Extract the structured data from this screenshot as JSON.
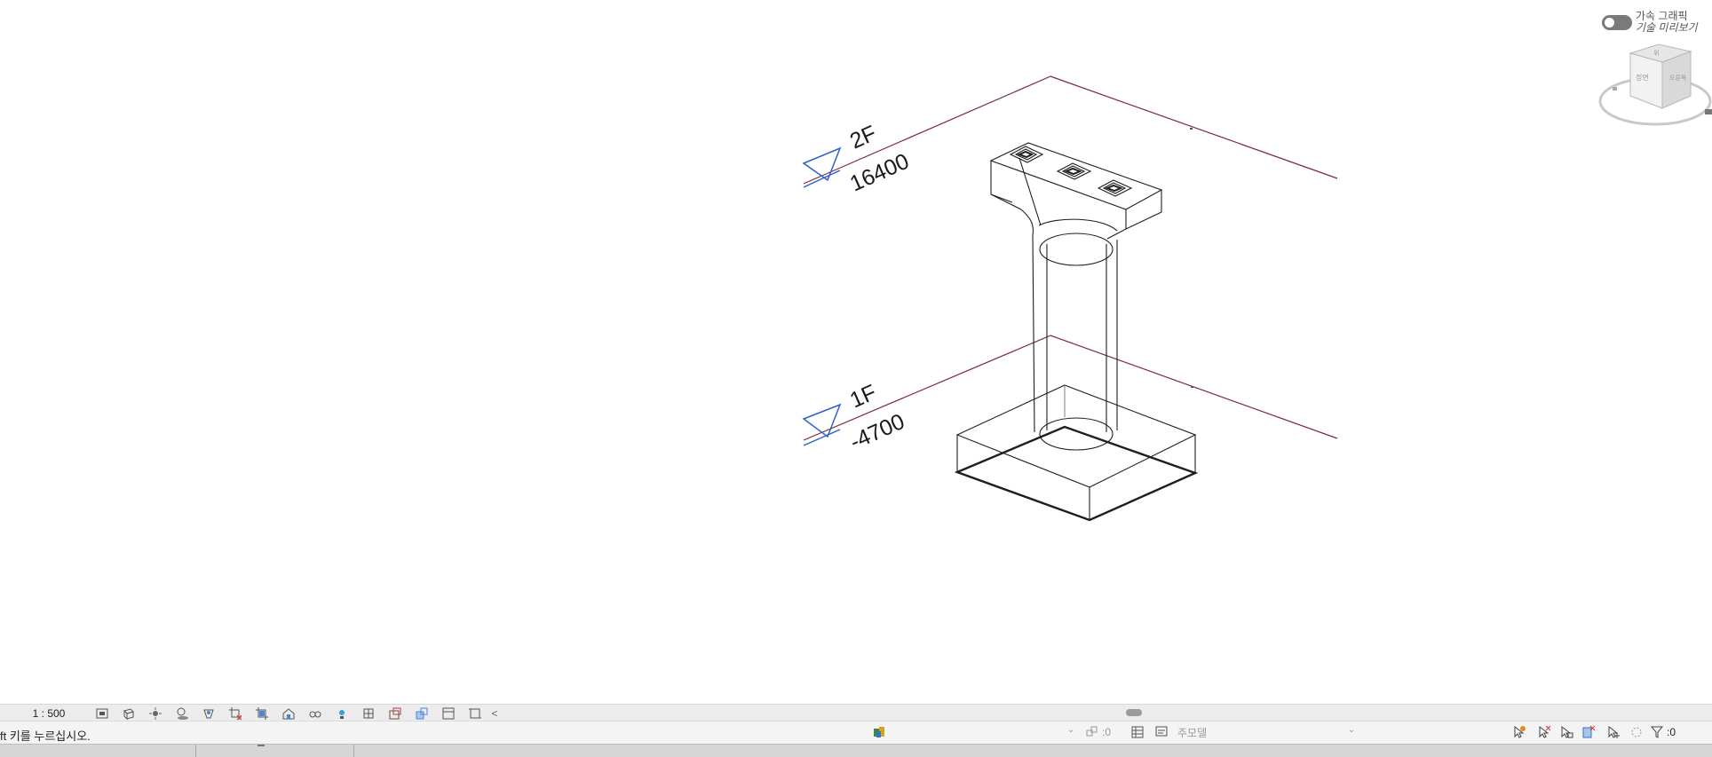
{
  "graphics": {
    "accel_label": "가속 그래픽",
    "preview_label": "기술 미리보기"
  },
  "viewcube": {
    "top_face": "위",
    "front_face": "정면",
    "right_face": "오른쪽"
  },
  "levels": [
    {
      "name": "2F",
      "elevation": "16400"
    },
    {
      "name": "1F",
      "elevation": "-4700"
    }
  ],
  "view_control_bar": {
    "scale": "1 : 500",
    "icons": [
      "detail-level-icon",
      "visual-style-icon",
      "sun-path-icon",
      "shadows-icon",
      "show-rendering-icon",
      "crop-view-icon",
      "show-crop-region-icon",
      "unlock-3d-view-icon",
      "temporary-hide-isolate-icon",
      "reveal-hidden-icon",
      "analytical-model-icon",
      "highlight-displacement-icon",
      "show-constraints-icon",
      "worksharing-display-icon",
      "crop-region-icon"
    ],
    "scroll_left": "<"
  },
  "status_bar": {
    "message": "ft 키를 누르십시오.",
    "worksets_count": ":0",
    "model_label": "주모델",
    "filter_count": ":0"
  }
}
